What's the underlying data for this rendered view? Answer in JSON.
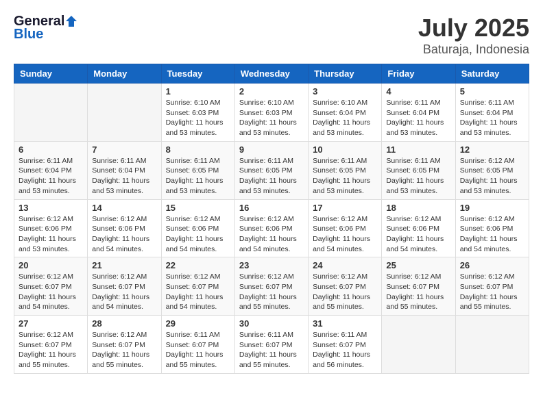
{
  "header": {
    "logo_general": "General",
    "logo_blue": "Blue",
    "title": "July 2025",
    "subtitle": "Baturaja, Indonesia"
  },
  "weekdays": [
    "Sunday",
    "Monday",
    "Tuesday",
    "Wednesday",
    "Thursday",
    "Friday",
    "Saturday"
  ],
  "weeks": [
    [
      {
        "day": "",
        "info": ""
      },
      {
        "day": "",
        "info": ""
      },
      {
        "day": "1",
        "info": "Sunrise: 6:10 AM\nSunset: 6:03 PM\nDaylight: 11 hours and 53 minutes."
      },
      {
        "day": "2",
        "info": "Sunrise: 6:10 AM\nSunset: 6:03 PM\nDaylight: 11 hours and 53 minutes."
      },
      {
        "day": "3",
        "info": "Sunrise: 6:10 AM\nSunset: 6:04 PM\nDaylight: 11 hours and 53 minutes."
      },
      {
        "day": "4",
        "info": "Sunrise: 6:11 AM\nSunset: 6:04 PM\nDaylight: 11 hours and 53 minutes."
      },
      {
        "day": "5",
        "info": "Sunrise: 6:11 AM\nSunset: 6:04 PM\nDaylight: 11 hours and 53 minutes."
      }
    ],
    [
      {
        "day": "6",
        "info": "Sunrise: 6:11 AM\nSunset: 6:04 PM\nDaylight: 11 hours and 53 minutes."
      },
      {
        "day": "7",
        "info": "Sunrise: 6:11 AM\nSunset: 6:04 PM\nDaylight: 11 hours and 53 minutes."
      },
      {
        "day": "8",
        "info": "Sunrise: 6:11 AM\nSunset: 6:05 PM\nDaylight: 11 hours and 53 minutes."
      },
      {
        "day": "9",
        "info": "Sunrise: 6:11 AM\nSunset: 6:05 PM\nDaylight: 11 hours and 53 minutes."
      },
      {
        "day": "10",
        "info": "Sunrise: 6:11 AM\nSunset: 6:05 PM\nDaylight: 11 hours and 53 minutes."
      },
      {
        "day": "11",
        "info": "Sunrise: 6:11 AM\nSunset: 6:05 PM\nDaylight: 11 hours and 53 minutes."
      },
      {
        "day": "12",
        "info": "Sunrise: 6:12 AM\nSunset: 6:05 PM\nDaylight: 11 hours and 53 minutes."
      }
    ],
    [
      {
        "day": "13",
        "info": "Sunrise: 6:12 AM\nSunset: 6:06 PM\nDaylight: 11 hours and 53 minutes."
      },
      {
        "day": "14",
        "info": "Sunrise: 6:12 AM\nSunset: 6:06 PM\nDaylight: 11 hours and 54 minutes."
      },
      {
        "day": "15",
        "info": "Sunrise: 6:12 AM\nSunset: 6:06 PM\nDaylight: 11 hours and 54 minutes."
      },
      {
        "day": "16",
        "info": "Sunrise: 6:12 AM\nSunset: 6:06 PM\nDaylight: 11 hours and 54 minutes."
      },
      {
        "day": "17",
        "info": "Sunrise: 6:12 AM\nSunset: 6:06 PM\nDaylight: 11 hours and 54 minutes."
      },
      {
        "day": "18",
        "info": "Sunrise: 6:12 AM\nSunset: 6:06 PM\nDaylight: 11 hours and 54 minutes."
      },
      {
        "day": "19",
        "info": "Sunrise: 6:12 AM\nSunset: 6:06 PM\nDaylight: 11 hours and 54 minutes."
      }
    ],
    [
      {
        "day": "20",
        "info": "Sunrise: 6:12 AM\nSunset: 6:07 PM\nDaylight: 11 hours and 54 minutes."
      },
      {
        "day": "21",
        "info": "Sunrise: 6:12 AM\nSunset: 6:07 PM\nDaylight: 11 hours and 54 minutes."
      },
      {
        "day": "22",
        "info": "Sunrise: 6:12 AM\nSunset: 6:07 PM\nDaylight: 11 hours and 54 minutes."
      },
      {
        "day": "23",
        "info": "Sunrise: 6:12 AM\nSunset: 6:07 PM\nDaylight: 11 hours and 55 minutes."
      },
      {
        "day": "24",
        "info": "Sunrise: 6:12 AM\nSunset: 6:07 PM\nDaylight: 11 hours and 55 minutes."
      },
      {
        "day": "25",
        "info": "Sunrise: 6:12 AM\nSunset: 6:07 PM\nDaylight: 11 hours and 55 minutes."
      },
      {
        "day": "26",
        "info": "Sunrise: 6:12 AM\nSunset: 6:07 PM\nDaylight: 11 hours and 55 minutes."
      }
    ],
    [
      {
        "day": "27",
        "info": "Sunrise: 6:12 AM\nSunset: 6:07 PM\nDaylight: 11 hours and 55 minutes."
      },
      {
        "day": "28",
        "info": "Sunrise: 6:12 AM\nSunset: 6:07 PM\nDaylight: 11 hours and 55 minutes."
      },
      {
        "day": "29",
        "info": "Sunrise: 6:11 AM\nSunset: 6:07 PM\nDaylight: 11 hours and 55 minutes."
      },
      {
        "day": "30",
        "info": "Sunrise: 6:11 AM\nSunset: 6:07 PM\nDaylight: 11 hours and 55 minutes."
      },
      {
        "day": "31",
        "info": "Sunrise: 6:11 AM\nSunset: 6:07 PM\nDaylight: 11 hours and 56 minutes."
      },
      {
        "day": "",
        "info": ""
      },
      {
        "day": "",
        "info": ""
      }
    ]
  ]
}
